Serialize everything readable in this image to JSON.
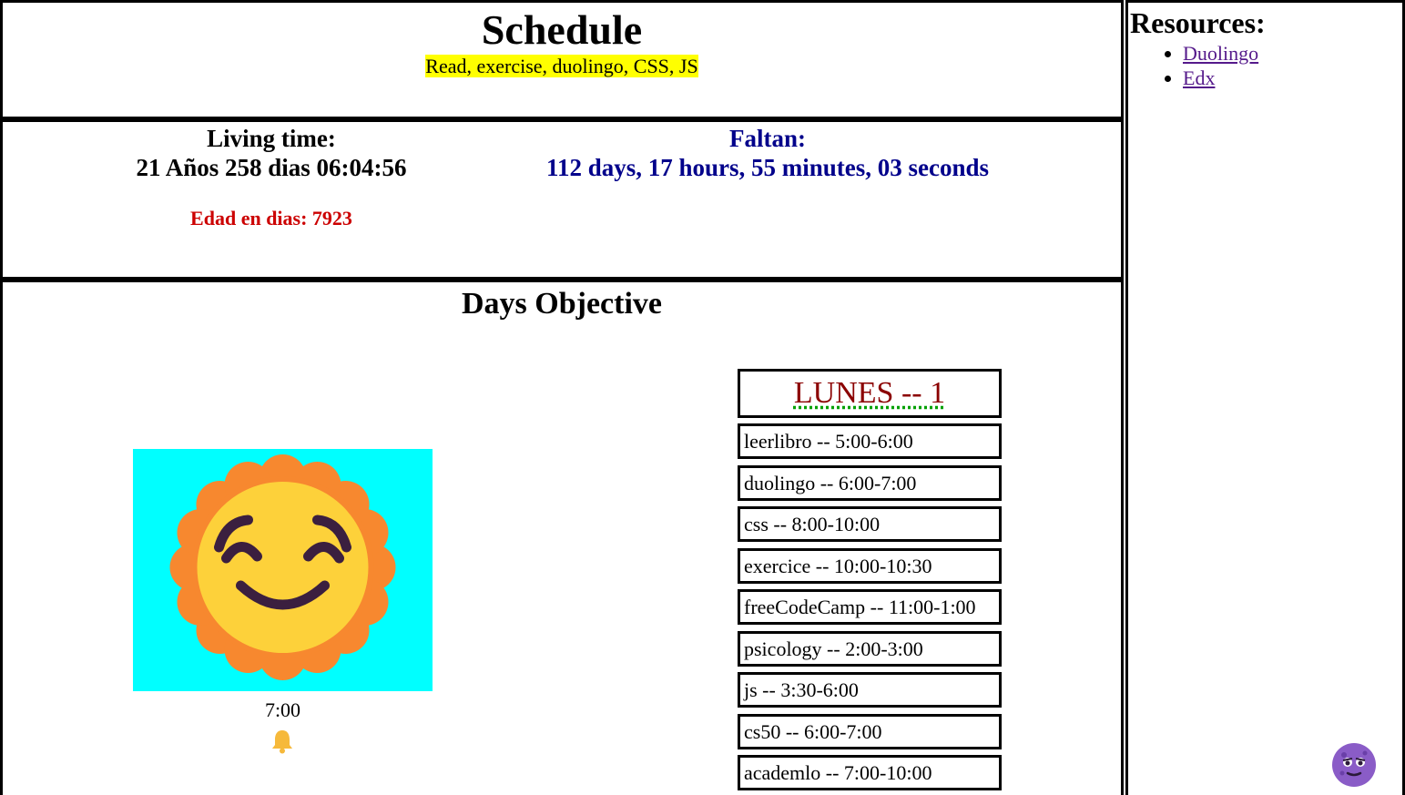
{
  "header": {
    "title": "Schedule",
    "subtitle": "Read, exercise, duolingo, CSS, JS"
  },
  "living": {
    "label": "Living time:",
    "value": "21 Años 258 dias 06:04:56",
    "edad": "Edad en dias: 7923"
  },
  "faltan": {
    "label": "Faltan:",
    "value": "112 days, 17 hours, 55 minutes, 03 seconds"
  },
  "objective": {
    "title": "Days Objective",
    "alarm_time": "7:00",
    "day_header": "LUNES -- 1",
    "tasks": [
      "leerlibro -- 5:00-6:00",
      "duolingo -- 6:00-7:00",
      "css -- 8:00-10:00",
      "exercice -- 10:00-10:30",
      "freeCodeCamp -- 11:00-1:00",
      "psicology -- 2:00-3:00",
      "js -- 3:30-6:00",
      "cs50 -- 6:00-7:00",
      "academlo -- 7:00-10:00"
    ]
  },
  "resources": {
    "title": "Resources:",
    "links": [
      "Duolingo",
      "Edx"
    ]
  },
  "icons": {
    "sun": "smiling-sun-icon",
    "bell": "bell-icon",
    "avatar": "purple-face-icon"
  },
  "colors": {
    "subtitle_highlight": "#ffff00",
    "faltan_text": "#00008b",
    "edad_text": "#cc0000",
    "day_header_text": "#8b0000",
    "sun_background": "#00ffff",
    "link": "#551a8b"
  }
}
